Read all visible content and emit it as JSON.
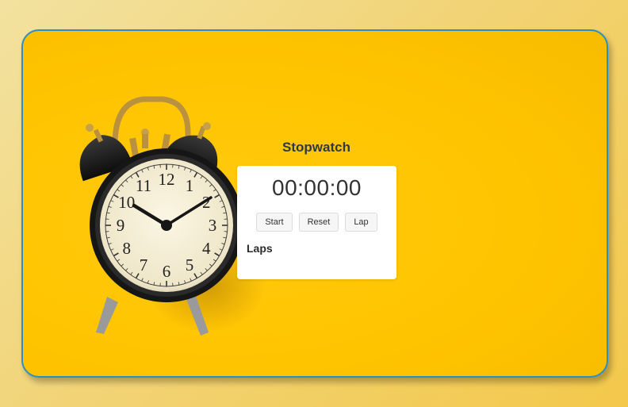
{
  "app": {
    "title": "Stopwatch"
  },
  "stopwatch": {
    "time_display": "00:00:00",
    "buttons": {
      "start_label": "Start",
      "reset_label": "Reset",
      "lap_label": "Lap"
    },
    "laps_heading": "Laps",
    "laps": []
  },
  "decor": {
    "image": "alarm-clock-icon",
    "clock_numerals": [
      "12",
      "1",
      "2",
      "3",
      "4",
      "5",
      "6",
      "7",
      "8",
      "9",
      "10",
      "11"
    ]
  },
  "colors": {
    "background_accent": "#ffc400",
    "frame_border": "#2a8fc4",
    "card_background": "#ffffff",
    "title_text": "#2f3a3f"
  }
}
